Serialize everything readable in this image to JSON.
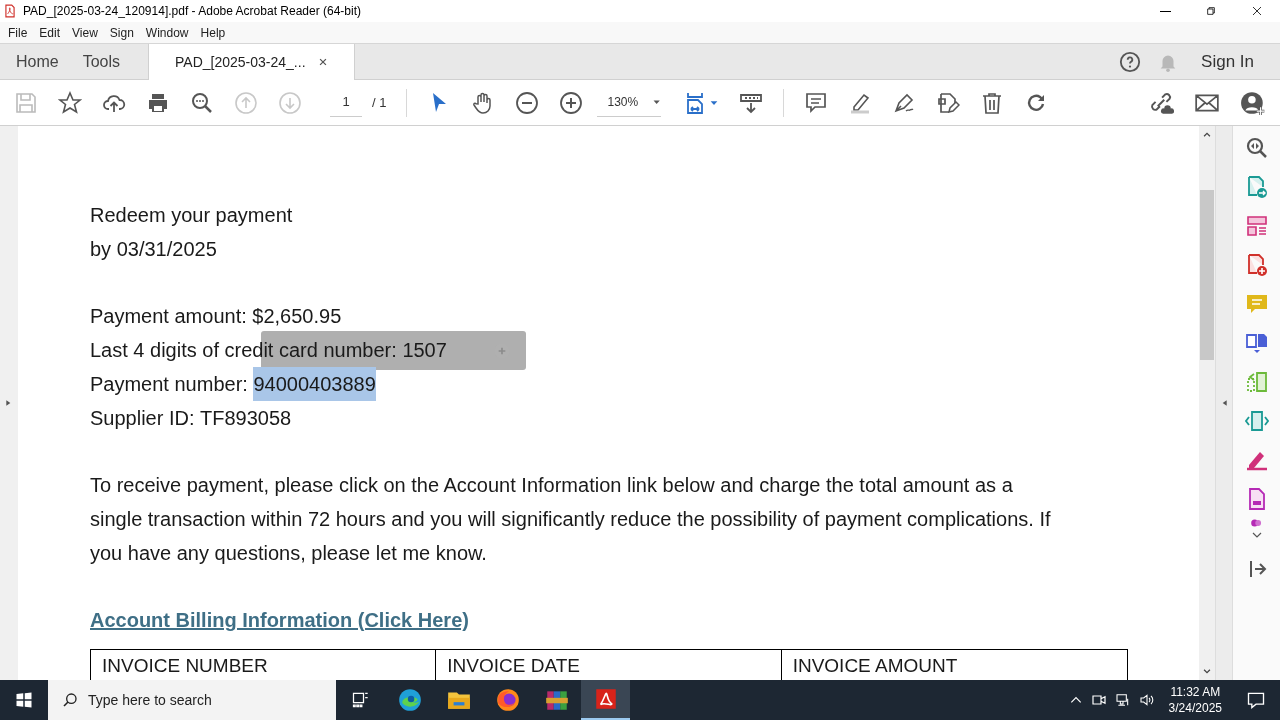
{
  "window": {
    "title": "PAD_[2025-03-24_120914].pdf - Adobe Acrobat Reader (64-bit)"
  },
  "menu": [
    "File",
    "Edit",
    "View",
    "Sign",
    "Window",
    "Help"
  ],
  "tabs": [
    {
      "label": "Home",
      "selected": false
    },
    {
      "label": "Tools",
      "selected": false
    },
    {
      "label": "PAD_[2025-03-24_...",
      "selected": true,
      "closable": true
    }
  ],
  "sign_in": "Sign In",
  "toolbar": {
    "page": "1",
    "page_total": "/ 1",
    "zoom": "130%"
  },
  "document": {
    "blocks": [
      {
        "kind": "line",
        "text": "Redeem your payment"
      },
      {
        "kind": "line",
        "text": "by 03/31/2025"
      },
      {
        "kind": "gap"
      },
      {
        "kind": "field",
        "label": "Payment amount: ",
        "value": "$2,650.95",
        "highlighted": false
      },
      {
        "kind": "field",
        "label": "Last 4 digits of credit card number: ",
        "value": "1507",
        "highlighted": false
      },
      {
        "kind": "field",
        "label": "Payment number: ",
        "value": "94000403889",
        "highlighted": true
      },
      {
        "kind": "field",
        "label": "Supplier ID: ",
        "value": "TF893058",
        "highlighted": false
      },
      {
        "kind": "gap"
      },
      {
        "kind": "paragraph",
        "text": "To receive payment, please click on the Account Information link below and charge the total amount as a single transaction within 72 hours and you will significantly reduce the possibility of payment complications. If you have any questions, please let me know."
      },
      {
        "kind": "gap"
      },
      {
        "kind": "link",
        "text": "Account Billing Information (Click Here)"
      }
    ],
    "table": {
      "columns": [
        "INVOICE NUMBER",
        "INVOICE DATE",
        "INVOICE AMOUNT"
      ]
    }
  },
  "taskbar": {
    "search_placeholder": "Type here to search",
    "apps": [
      {
        "kind": "taskview",
        "active": false
      },
      {
        "kind": "edge",
        "active": false
      },
      {
        "kind": "explorer",
        "active": false
      },
      {
        "kind": "firefox",
        "active": false
      },
      {
        "kind": "archiver",
        "active": false
      },
      {
        "kind": "acrobat",
        "active": true
      }
    ],
    "time": "11:32 AM",
    "date": "3/24/2025"
  }
}
